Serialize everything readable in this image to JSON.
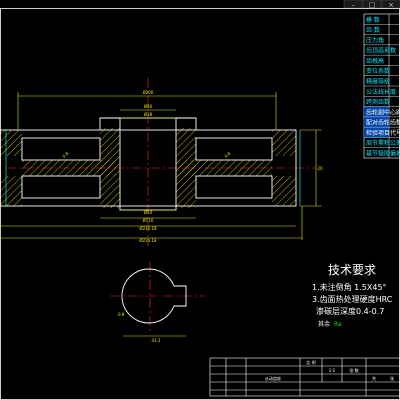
{
  "window": {
    "ctrl_buttons": [
      "–",
      "□",
      "×"
    ]
  },
  "colors": {
    "background": "#000000",
    "outline": "#ffffff",
    "dimension": "#e8e800",
    "centerline": "#ff2020",
    "hatch": "#e8e000",
    "tolerance": "#00e8e8",
    "table_text": "#00e8ff",
    "table_header_text": "#ffffff",
    "title_block": "#ffffff",
    "notes_text": "#ffffff"
  },
  "param_table": {
    "rows": [
      {
        "label": "模 数",
        "highlight": false
      },
      {
        "label": "齿 数",
        "highlight": false
      },
      {
        "label": "压力角",
        "highlight": false
      },
      {
        "label": "齿顶高系数",
        "highlight": false
      },
      {
        "label": "齿根高",
        "highlight": false
      },
      {
        "label": "变位系数",
        "highlight": false
      },
      {
        "label": "精度等级",
        "highlight": false
      },
      {
        "label": "公法线长度",
        "highlight": false
      },
      {
        "label": "跨测齿数",
        "highlight": false
      },
      {
        "label": "齿轮副中心距",
        "highlight": true
      },
      {
        "label": "配对齿轮齿数",
        "highlight": true
      },
      {
        "label": "检验项目代号",
        "highlight": true
      },
      {
        "label": "周节累积公差",
        "highlight": false
      },
      {
        "label": "基节极限偏差",
        "highlight": false
      }
    ]
  },
  "drawing": {
    "dims_top": [
      "Ø200",
      "Ø80",
      "Ø38"
    ],
    "dims_bottom": [
      "Ø54",
      "Ø116",
      "Ø216.18",
      "Ø226.18"
    ],
    "tol_labels": [
      "0.8",
      "0.8"
    ],
    "right_dim": "20"
  },
  "tech_notes": {
    "title": "技术要求",
    "lines": [
      "1.未注倒角 1.5X45°",
      "3.齿面热处理硬度HRC",
      "渗碳层深度0.4-0.7"
    ],
    "roughness": "其余",
    "roughness_value": "Ra"
  },
  "section_view": {
    "label": "43.3"
  },
  "title_block": {
    "cells": [
      "比 例",
      "1:1",
      "从动齿轮",
      "张 数",
      "共",
      "张"
    ]
  }
}
